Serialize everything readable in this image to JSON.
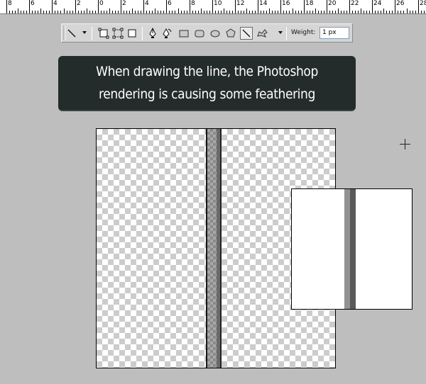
{
  "ruler": {
    "labels": [
      "8",
      "6",
      "4",
      "2",
      "0",
      "2",
      "4",
      "6",
      "8",
      "10",
      "12",
      "14",
      "16",
      "18",
      "20",
      "22",
      "24",
      "26",
      "28"
    ]
  },
  "toolbar": {
    "tools": [
      "line-tool-icon",
      "shape-layers-icon",
      "paths-icon",
      "fill-pixels-icon",
      "pen-icon",
      "freeform-pen-icon",
      "rectangle-icon",
      "rounded-rectangle-icon",
      "ellipse-icon",
      "polygon-icon",
      "line-icon",
      "custom-shape-icon"
    ],
    "active_tool": "line-icon",
    "weight_label": "Weight:",
    "weight_value": "1 px"
  },
  "caption": {
    "text": "When drawing the line, the Photoshop rendering is causing some feathering"
  }
}
